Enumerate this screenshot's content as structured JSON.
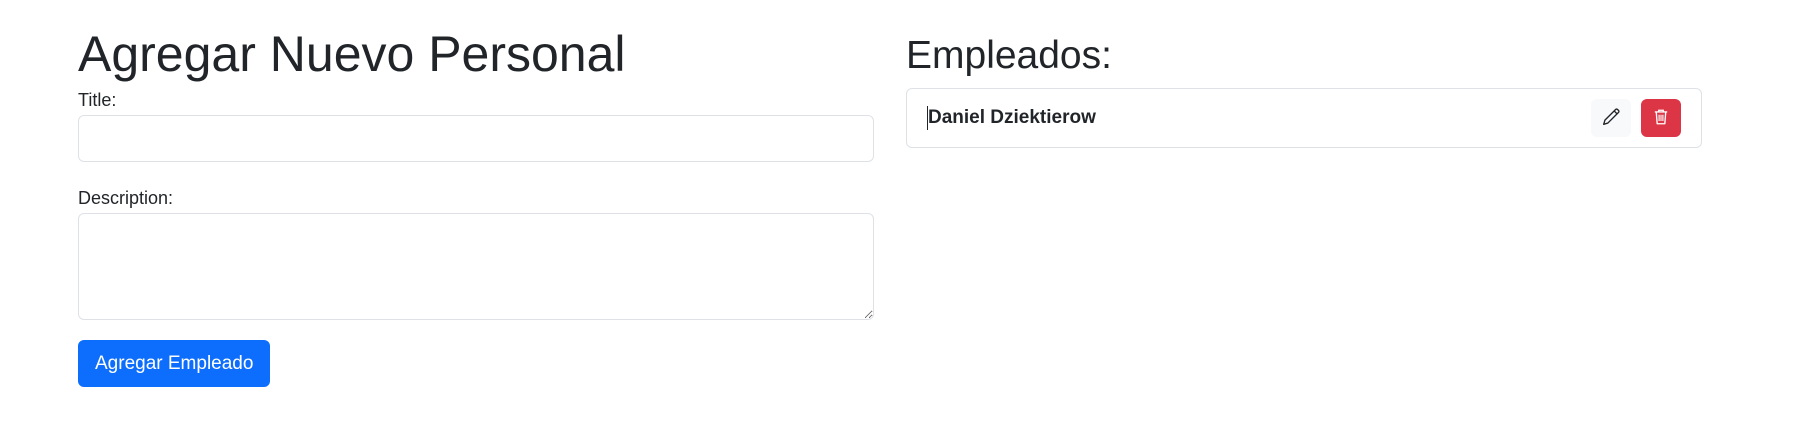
{
  "form": {
    "heading": "Agregar Nuevo Personal",
    "title_label": "Title:",
    "title_value": "",
    "description_label": "Description:",
    "description_value": "",
    "submit_label": "Agregar Empleado"
  },
  "employees": {
    "heading": "Empleados:",
    "items": [
      {
        "name": "Daniel Dziektierow",
        "edit_icon": "pencil-icon",
        "delete_icon": "trash-icon"
      }
    ]
  },
  "colors": {
    "primary": "#0d6efd",
    "danger": "#dc3545",
    "light": "#f8f9fa",
    "border": "#dee2e6",
    "text": "#212529"
  }
}
